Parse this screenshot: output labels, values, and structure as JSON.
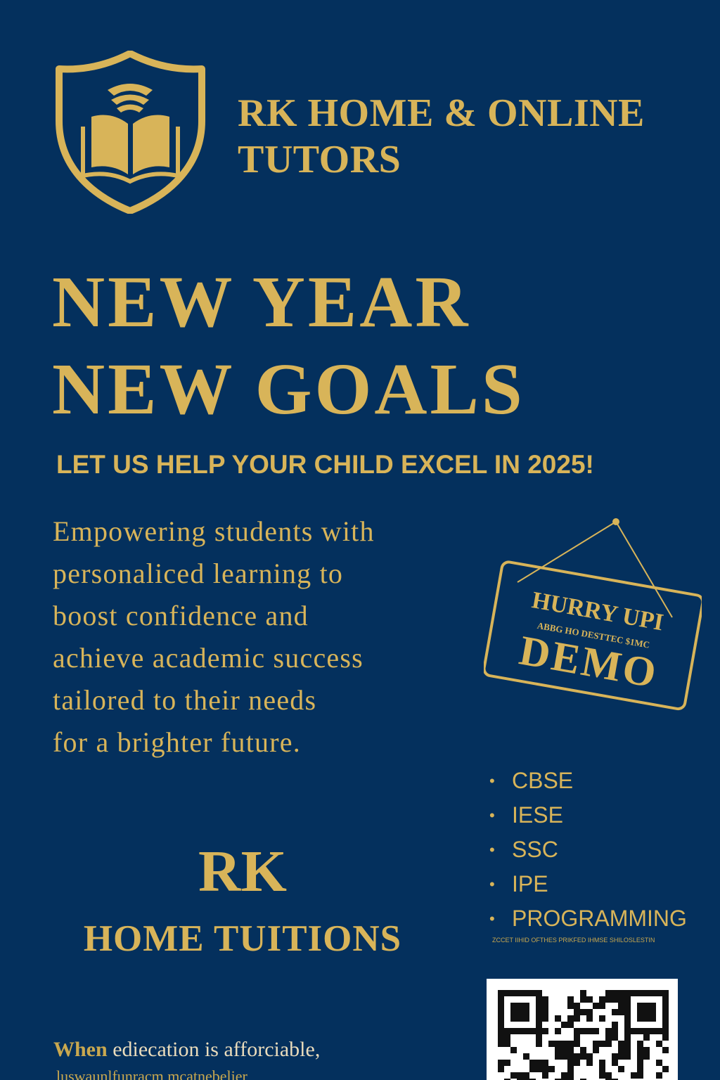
{
  "brand": {
    "name_line1": "RK HOME & ONLINE",
    "name_line2": "TUTORS",
    "logo_icon": "shield-book-icon"
  },
  "headline": {
    "line1": "NEW YEAR",
    "line2": "NEW GOALS"
  },
  "tagline": "LET US HELP YOUR CHILD EXCEL IN 2025!",
  "intro": {
    "lines": [
      "Empowering students with",
      "personaliced learning to",
      "boost confidence and",
      "achieve academic success",
      "tailored to their needs",
      "for a brighter future."
    ]
  },
  "demo_sign": {
    "hurry": "HURRY UPI",
    "small": "ABBG HO DESTTEC $1MC",
    "demo": "DEMO"
  },
  "subjects": {
    "items": [
      "CBSE",
      "IESE",
      "SSC",
      "IPE",
      "PROGRAMMING"
    ],
    "fine_print": "ZCCET IIHID OFTHES PRIKFED IHMSE SHILOSLESTIN"
  },
  "footer_brand": {
    "rk": "RK",
    "subtitle": "HOME TUITIONS"
  },
  "footer": {
    "line1_prefix": "When",
    "line1_rest": " ediecation is afforciable,",
    "line2": "luswaunlfunracm mcatnebelier"
  },
  "qr_icon": "qr-code-icon",
  "colors": {
    "background": "#04305d",
    "gold": "#d8b459",
    "cream": "#eadcbc"
  }
}
